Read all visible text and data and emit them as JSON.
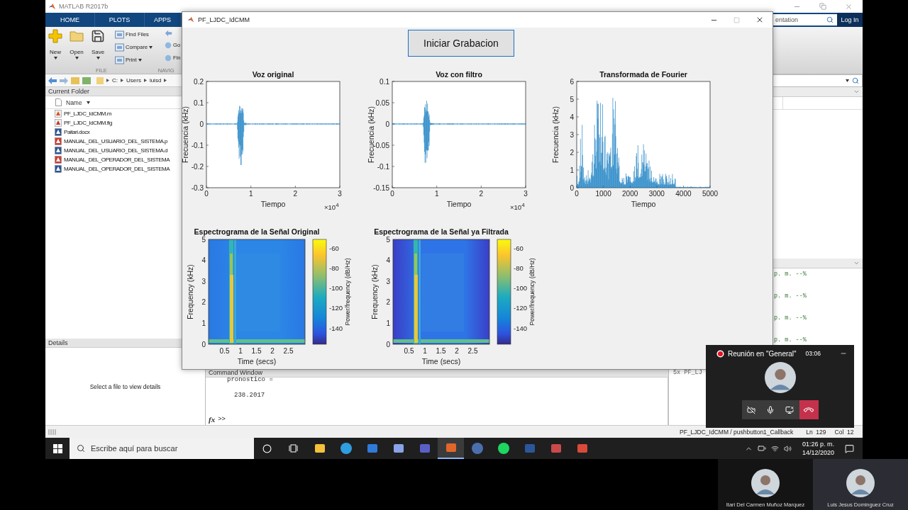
{
  "matlab": {
    "title": "MATLAB R2017b",
    "tabs": [
      "HOME",
      "PLOTS",
      "APPS"
    ],
    "search": {
      "placeholder": "entation"
    },
    "login": "Log In",
    "big_buttons": [
      "New",
      "Open",
      "Save"
    ],
    "file_actions": [
      "Find Files",
      "Compare",
      "Print"
    ],
    "nav_actions": [
      "Go",
      "Fin"
    ],
    "sections": [
      "FILE",
      "NAVIG"
    ],
    "path": [
      "C:",
      "Users",
      "luisd"
    ],
    "current_folder": {
      "title": "Current Folder",
      "column": "Name",
      "files": [
        {
          "name": "PF_LJDC_IdCMM.m",
          "kind": "script"
        },
        {
          "name": "PF_LJDC_IdCMM.fig",
          "kind": "figure"
        },
        {
          "name": "Paitari.docx",
          "kind": "word"
        },
        {
          "name": "MANUAL_DEL_USUARIO_DEL_SISTEMA.p",
          "kind": "pdf"
        },
        {
          "name": "MANUAL_DEL_USUARIO_DEL_SISTEMA.d",
          "kind": "word"
        },
        {
          "name": "MANUAL_DEL_OPERADOR_DEL_SISTEMA",
          "kind": "pdf"
        },
        {
          "name": "MANUAL_DEL_OPERADOR_DEL_SISTEMA",
          "kind": "word"
        }
      ]
    },
    "details": {
      "title": "Details",
      "message": "Select a file to view details"
    },
    "command_window": {
      "title": "Command Window",
      "lines": [
        "pronostico =",
        "238.2017"
      ],
      "fx": "fx",
      "prompt": ">>"
    },
    "history": {
      "lines": [
        "p. m. --%",
        "p. m. --%",
        "p. m. --%",
        "p. m. --%"
      ],
      "snippet": "5x PF_LJ"
    },
    "status_bar": {
      "context": "PF_LJDC_IdCMM / pushbutton1_Callback",
      "line": "Ln  129",
      "column": "Col  12"
    }
  },
  "figure": {
    "title": "PF_LJDC_IdCMM",
    "record_button": "Iniciar Grabacion",
    "plots": [
      {
        "kind": "waveform",
        "title": "Voz original",
        "ylabel": "Frecuencia (kHz)",
        "xlabel": "Tiempo",
        "yticks": [
          "0.2",
          "0.1",
          "0",
          "-0.1",
          "-0.2",
          "-0.3"
        ],
        "xticks": [
          "0",
          "1",
          "2",
          "3"
        ],
        "exponent": "×10$^{4}$"
      },
      {
        "kind": "waveform",
        "title": "Voz con filtro",
        "ylabel": "Frecuencia (kHz)",
        "xlabel": "Tiempo",
        "yticks": [
          "0.1",
          "0.05",
          "0",
          "-0.05",
          "-0.1",
          "-0.15"
        ],
        "xticks": [
          "0",
          "1",
          "2",
          "3"
        ],
        "exponent": "×10$^{4}$"
      },
      {
        "kind": "spectrum",
        "title": "Transformada de Fourier",
        "ylabel": "Frecuencia (kHz)",
        "xlabel": "Tiempo",
        "yticks": [
          "6",
          "5",
          "4",
          "3",
          "2",
          "1",
          "0"
        ],
        "xticks": [
          "0",
          "1000",
          "2000",
          "3000",
          "4000",
          "5000"
        ]
      }
    ],
    "spectrograms": [
      {
        "kind": "original",
        "title": "Espectrograma de la Señal Original",
        "ylabel": "Frequency (kHz)",
        "xlabel": "Time (secs)",
        "yticks": [
          "5",
          "4",
          "3",
          "2",
          "1",
          "0"
        ],
        "xticks": [
          "0.5",
          "1",
          "1.5",
          "2",
          "2.5"
        ],
        "colorbar_ticks": [
          "-60",
          "-80",
          "-100",
          "-120",
          "-140"
        ],
        "colorbar_label": "Power/frequency (dB/Hz)"
      },
      {
        "kind": "filtered",
        "title": "Espectrograma de la Señal ya Filtrada",
        "ylabel": "Frequency (kHz)",
        "xlabel": "Time (secs)",
        "yticks": [
          "5",
          "4",
          "3",
          "2",
          "1",
          "0"
        ],
        "xticks": [
          "0.5",
          "1",
          "1.5",
          "2",
          "2.5"
        ],
        "colorbar_ticks": [
          "-60",
          "-80",
          "-100",
          "-120",
          "-140"
        ],
        "colorbar_label": "Power/frequency (dB/Hz)"
      }
    ]
  },
  "meeting": {
    "title": "Reunión en \"General\"",
    "timer": "03:06"
  },
  "taskbar": {
    "search_placeholder": "Escribe aquí para buscar",
    "time": "01:26 p. m.",
    "date": "14/12/2020"
  },
  "participants": [
    {
      "name": "Itari Del Carmen Muñoz Marquez"
    },
    {
      "name": "Luis Jesus Dominguez Cruz"
    }
  ]
}
